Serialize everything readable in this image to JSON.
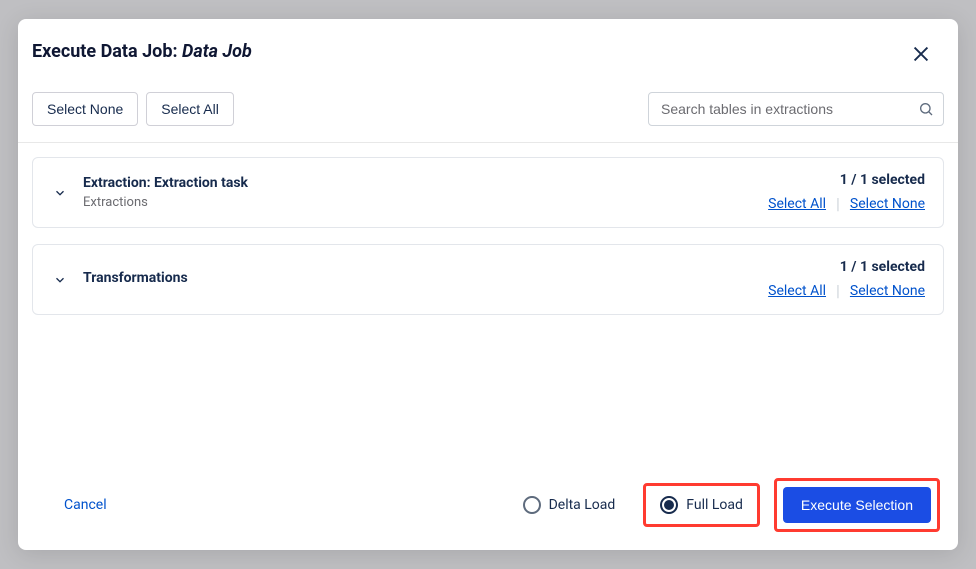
{
  "modal": {
    "title_prefix": "Execute Data Job: ",
    "title_name": "Data Job"
  },
  "toolbar": {
    "select_none": "Select None",
    "select_all": "Select All",
    "search_placeholder": "Search tables in extractions"
  },
  "sections": [
    {
      "title": "Extraction: Extraction task",
      "subtitle": "Extractions",
      "selected_text": "1 / 1 selected",
      "select_all": "Select All",
      "select_none": "Select None"
    },
    {
      "title": "Transformations",
      "subtitle": "",
      "selected_text": "1 / 1 selected",
      "select_all": "Select All",
      "select_none": "Select None"
    }
  ],
  "footer": {
    "cancel": "Cancel",
    "delta_load": "Delta Load",
    "full_load": "Full Load",
    "execute": "Execute Selection"
  }
}
